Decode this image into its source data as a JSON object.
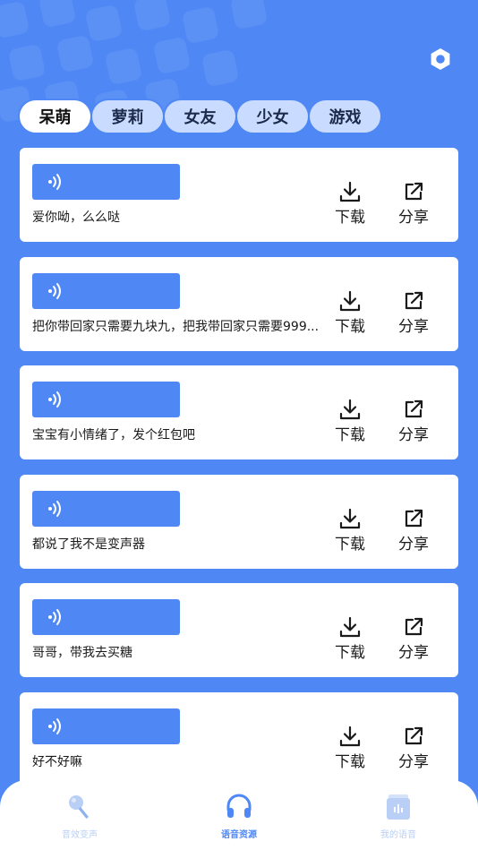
{
  "theme": {
    "primary": "#4f88f5",
    "tab_inactive": "#c9dcff",
    "card": "#ffffff",
    "nav_inactive": "#b9cff5"
  },
  "header": {
    "settings_icon": "hexagon-gear-icon"
  },
  "tabs": [
    {
      "label": "呆萌",
      "active": true
    },
    {
      "label": "萝莉",
      "active": false
    },
    {
      "label": "女友",
      "active": false
    },
    {
      "label": "少女",
      "active": false
    },
    {
      "label": "游戏",
      "active": false
    }
  ],
  "actions": {
    "download_label": "下载",
    "share_label": "分享"
  },
  "voices": [
    {
      "text": "爱你呦，么么哒"
    },
    {
      "text": "把你带回家只需要九块九，把我带回家只需要999..."
    },
    {
      "text": "宝宝有小情绪了，发个红包吧"
    },
    {
      "text": "都说了我不是变声器"
    },
    {
      "text": "哥哥，带我去买糖"
    },
    {
      "text": "好不好嘛"
    }
  ],
  "bottom_nav": [
    {
      "label": "音效变声",
      "icon": "microphone-icon",
      "active": false
    },
    {
      "label": "语音资源",
      "icon": "headphones-icon",
      "active": true
    },
    {
      "label": "我的语音",
      "icon": "voice-file-icon",
      "active": false
    }
  ]
}
